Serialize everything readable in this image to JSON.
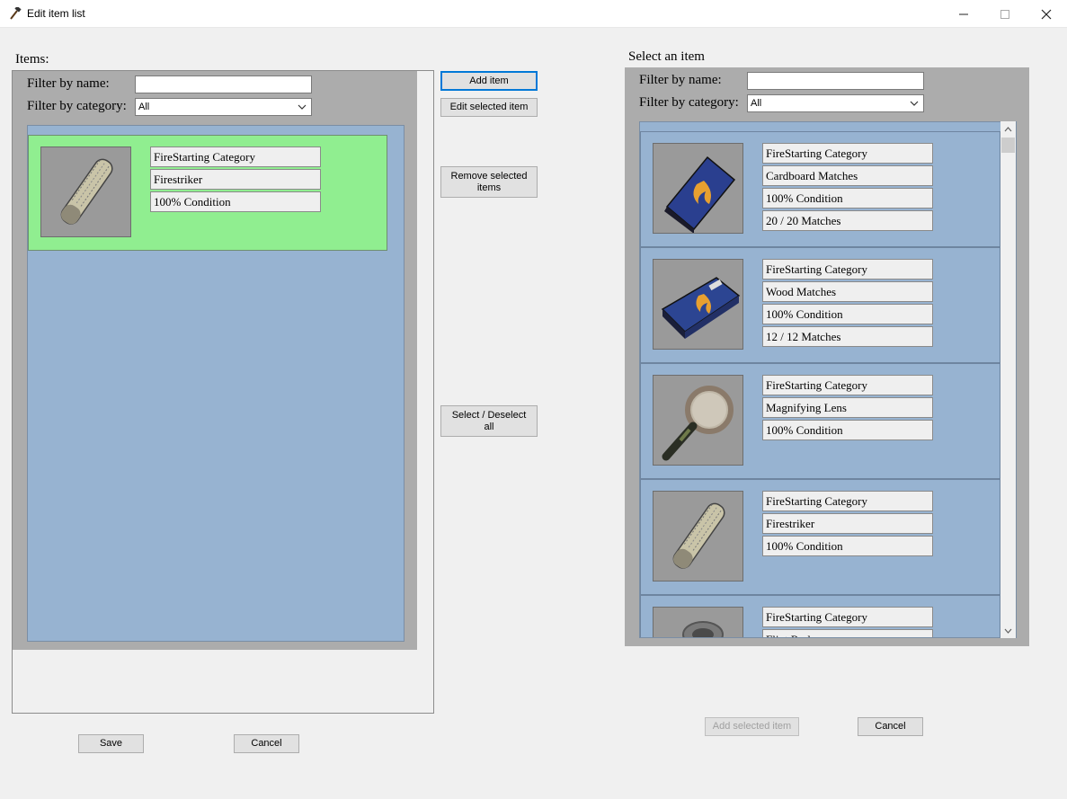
{
  "window": {
    "title": "Edit item list",
    "icon": "hammer-icon",
    "controls": [
      "minimize-icon",
      "maximize-icon",
      "close-icon"
    ]
  },
  "left_panel": {
    "group_label": "Items:",
    "filter_name_label": "Filter by name:",
    "filter_name_value": "",
    "filter_category_label": "Filter by category:",
    "filter_category_value": "All",
    "items": [
      {
        "image": "firestriker-image",
        "selected": true,
        "fields": [
          "FireStarting Category",
          "Firestriker",
          "100% Condition"
        ]
      }
    ]
  },
  "middle_buttons": {
    "add": "Add item",
    "edit": "Edit selected item",
    "remove": "Remove selected items",
    "select_all": "Select / Deselect all"
  },
  "left_footer": {
    "save": "Save",
    "cancel": "Cancel"
  },
  "right_panel": {
    "group_label": "Select an item",
    "filter_name_label": "Filter by name:",
    "filter_name_value": "",
    "filter_category_label": "Filter by category:",
    "filter_category_value": "All",
    "items": [
      {
        "image": "cardboard-matches-image",
        "fields": [
          "FireStarting Category",
          "Cardboard Matches",
          "100% Condition",
          "20 / 20 Matches"
        ]
      },
      {
        "image": "wood-matches-image",
        "fields": [
          "FireStarting Category",
          "Wood Matches",
          "100% Condition",
          "12 / 12 Matches"
        ]
      },
      {
        "image": "magnifying-lens-image",
        "fields": [
          "FireStarting Category",
          "Magnifying Lens",
          "100% Condition"
        ]
      },
      {
        "image": "firestriker-image",
        "fields": [
          "FireStarting Category",
          "Firestriker",
          "100% Condition"
        ]
      },
      {
        "image": "flint-rod-image",
        "fields": [
          "FireStarting Category",
          "Flint Rod"
        ]
      }
    ]
  },
  "right_footer": {
    "add_selected": "Add selected item",
    "cancel": "Cancel"
  },
  "colors": {
    "card_blue": "#97b3d1",
    "card_selected_green": "#90ee90",
    "panel_gray": "#acacac",
    "focus_blue": "#0078d7"
  }
}
